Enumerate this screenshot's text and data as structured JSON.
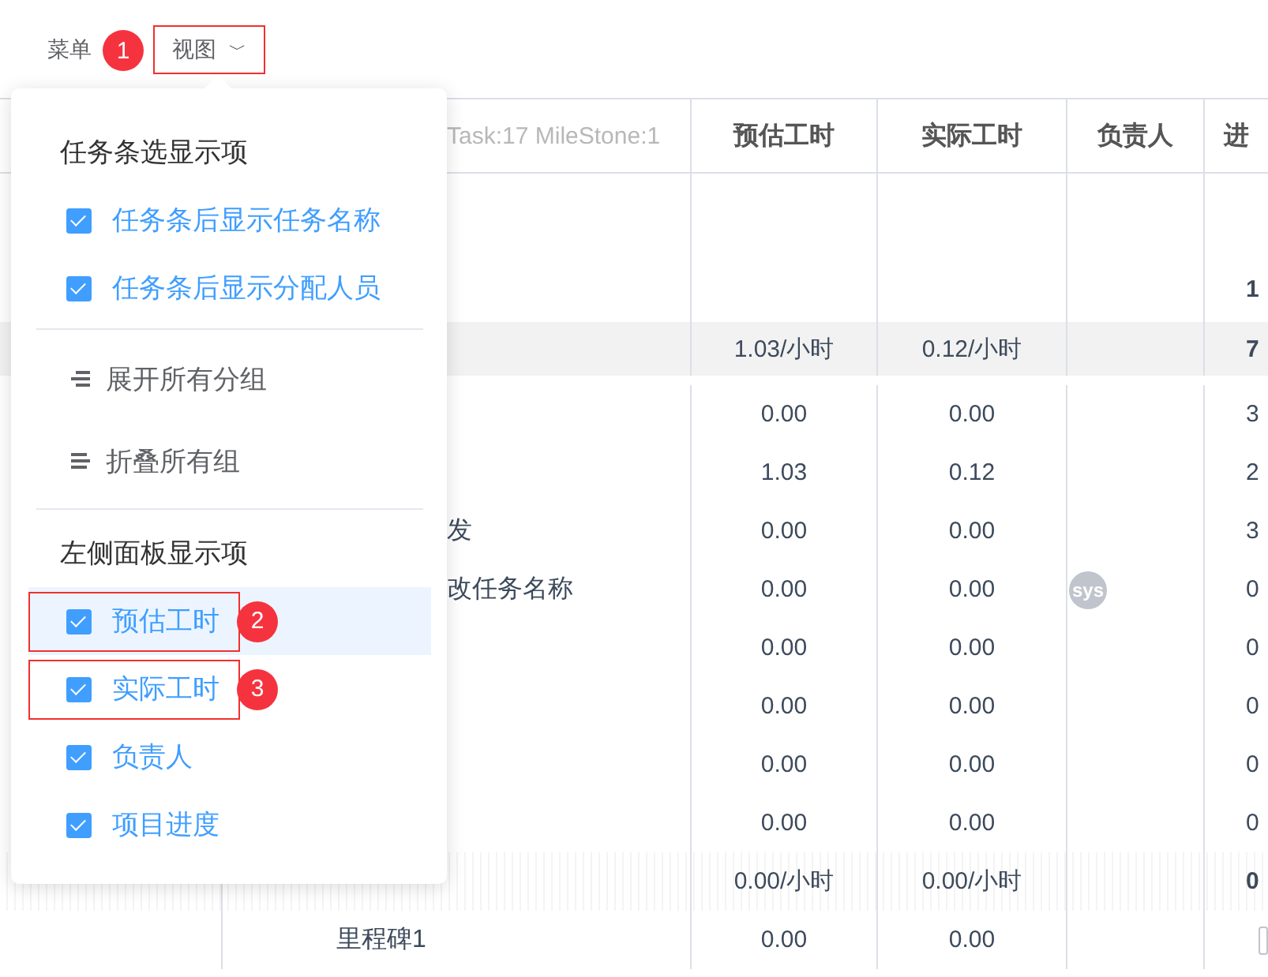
{
  "toolbar": {
    "menu_label": "菜单",
    "step_badge": "1",
    "view_button": {
      "label": "视图",
      "caret": "﹀"
    }
  },
  "table": {
    "columns": [
      "Task:17 MileStone:1",
      "预估工时",
      "实际工时",
      "负责人",
      "进"
    ],
    "rows": [
      {
        "kind": "blank"
      },
      {
        "kind": "project",
        "progress": "1"
      },
      {
        "kind": "summary",
        "estimate": "1.03/小时",
        "actual": "0.12/小时",
        "progress": "7"
      },
      {
        "kind": "task",
        "estimate": "0.00",
        "actual": "0.00",
        "progress": "3"
      },
      {
        "kind": "task",
        "estimate": "1.03",
        "actual": "0.12",
        "progress": "2"
      },
      {
        "kind": "task",
        "name": "发",
        "estimate": "0.00",
        "actual": "0.00",
        "progress": "3"
      },
      {
        "kind": "task",
        "name": "改任务名称",
        "estimate": "0.00",
        "actual": "0.00",
        "owner": "sys",
        "progress": "0"
      },
      {
        "kind": "task",
        "estimate": "0.00",
        "actual": "0.00",
        "progress": "0"
      },
      {
        "kind": "task",
        "estimate": "0.00",
        "actual": "0.00",
        "progress": "0"
      },
      {
        "kind": "task",
        "estimate": "0.00",
        "actual": "0.00",
        "progress": "0"
      },
      {
        "kind": "task",
        "estimate": "0.00",
        "actual": "0.00",
        "progress": "0"
      },
      {
        "kind": "group",
        "estimate": "0.00/小时",
        "actual": "0.00/小时",
        "progress": "0"
      },
      {
        "kind": "milestone",
        "name": "里程碑1",
        "estimate": "0.00",
        "actual": "0.00",
        "checked": false
      }
    ]
  },
  "dropdown": {
    "items": [
      {
        "kind": "header",
        "label": "任务条选显示项"
      },
      {
        "kind": "checkbox",
        "label": "任务条后显示任务名称",
        "checked": true,
        "selected": false
      },
      {
        "kind": "checkbox",
        "label": "任务条后显示分配人员",
        "checked": true,
        "selected": false
      },
      {
        "kind": "divider"
      },
      {
        "kind": "expand",
        "label": "展开所有分组"
      },
      {
        "kind": "collapse",
        "label": "折叠所有组"
      },
      {
        "kind": "divider"
      },
      {
        "kind": "header",
        "label": "左侧面板显示项"
      },
      {
        "kind": "checkbox",
        "label": "预估工时",
        "checked": true,
        "selected": true,
        "step_badge": "2"
      },
      {
        "kind": "checkbox",
        "label": "实际工时",
        "checked": true,
        "selected": false,
        "step_badge": "3"
      },
      {
        "kind": "checkbox",
        "label": "负责人",
        "checked": true,
        "selected": false
      },
      {
        "kind": "checkbox",
        "label": "项目进度",
        "checked": true,
        "selected": false
      }
    ]
  }
}
